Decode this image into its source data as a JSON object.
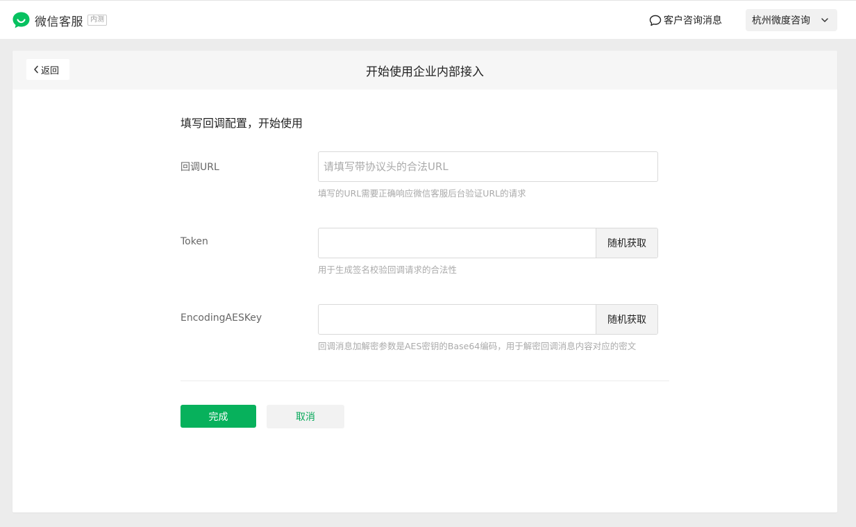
{
  "header": {
    "brand_name": "微信客服",
    "brand_badge": "内测",
    "messages_link": "客户咨询消息",
    "account_name": "杭州微度咨询"
  },
  "page": {
    "back_label": "返回",
    "title": "开始使用企业内部接入",
    "section_title": "填写回调配置，开始使用"
  },
  "form": {
    "url": {
      "label": "回调URL",
      "placeholder": "请填写带协议头的合法URL",
      "value": "",
      "hint": "填写的URL需要正确响应微信客服后台验证URL的请求"
    },
    "token": {
      "label": "Token",
      "value": "",
      "button": "随机获取",
      "hint": "用于生成签名校验回调请求的合法性"
    },
    "aes_key": {
      "label": "EncodingAESKey",
      "value": "",
      "button": "随机获取",
      "hint": "回调消息加解密参数是AES密钥的Base64编码，用于解密回调消息内容对应的密文"
    }
  },
  "actions": {
    "done": "完成",
    "cancel": "取消"
  },
  "colors": {
    "primary": "#07b15c",
    "cancel_text": "#07a85a",
    "background": "#ececec"
  },
  "icons": {
    "logo": "wechat-kf-logo-icon",
    "messages": "chat-bubble-icon",
    "account": "chevron-down-icon",
    "back": "chevron-left-icon"
  }
}
